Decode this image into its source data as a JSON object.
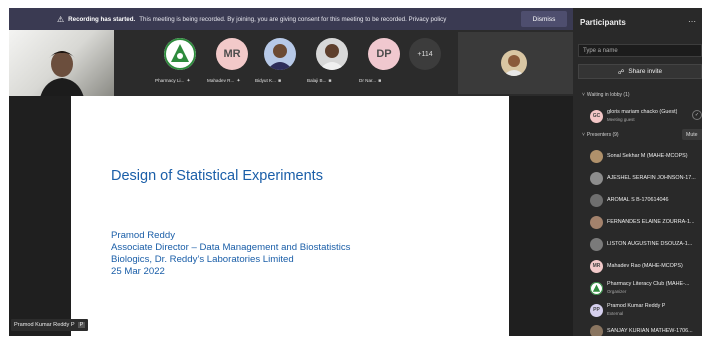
{
  "banner": {
    "title": "Recording has started.",
    "message": "This meeting is being recorded. By joining, you are giving consent for this meeting to be recorded. Privacy policy",
    "dismiss_label": "Dismiss"
  },
  "strip": {
    "tiles": [
      {
        "label": "Pharmacy Li...",
        "initials": "",
        "bg": "#ffffff",
        "icon": "club-logo-icon"
      },
      {
        "label": "Mahadev R...",
        "initials": "MR",
        "bg": "#f2c9c9",
        "icon": ""
      },
      {
        "label": "Bidyut K...",
        "initials": "",
        "bg": "#b7c9e8",
        "icon": "person-photo"
      },
      {
        "label": "Balaji B...",
        "initials": "",
        "bg": "#d8d8d8",
        "icon": "person-photo"
      },
      {
        "label": "Dr Nar...",
        "initials": "DP",
        "bg": "#f0c8cf",
        "icon": ""
      }
    ],
    "more_count": "+114"
  },
  "slide": {
    "title": "Design of Statistical Experiments",
    "lines": [
      "Pramod Reddy",
      "Associate Director – Data Management and Biostatistics",
      "Biologics, Dr. Reddy’s Laboratories Limited",
      "25 Mar 2022"
    ]
  },
  "presenter_tag": "Pramod Kumar Reddy P",
  "panel": {
    "title": "Participants",
    "search_placeholder": "Type a name",
    "invite_label": "Share invite",
    "lobby_header": "Waiting in lobby (1)",
    "lobby": [
      {
        "name": "gloris mariam chacko (Guest)",
        "sub": "Meeting guest",
        "initials": "GC",
        "bg": "#f3c6c6"
      }
    ],
    "presenters_header": "Presenters (9)",
    "mute_label": "Mute",
    "presenters": [
      {
        "name": "Sonal Sekhar M (MAHE-MCOPS)",
        "sub": "",
        "initials": "",
        "bg": "#b0916b"
      },
      {
        "name": "AJESHEL SERAFIN JOHNSON-17...",
        "sub": "",
        "initials": "",
        "bg": "#8d8d8d"
      },
      {
        "name": "AROMAL S B-170614046",
        "sub": "",
        "initials": "",
        "bg": "#6f6f6f"
      },
      {
        "name": "FERNANDES ELAINE ZOURRA-1...",
        "sub": "",
        "initials": "",
        "bg": "#a3826c"
      },
      {
        "name": "LISTON AUGUSTINE DSOUZA-1...",
        "sub": "",
        "initials": "",
        "bg": "#7a7a7a"
      },
      {
        "name": "Mahadev Rao (MAHE-MCOPS)",
        "sub": "",
        "initials": "MR",
        "bg": "#f2c9c9"
      },
      {
        "name": "Pharmacy Literacy Club (MAHE-...",
        "sub": "Organizer",
        "initials": "",
        "bg": "#ffffff"
      },
      {
        "name": "Pramod Kumar Reddy P",
        "sub": "External",
        "initials": "PP",
        "bg": "#d6d0ee"
      },
      {
        "name": "SANJAY KURIAN MATHEW-1706...",
        "sub": "",
        "initials": "",
        "bg": "#8a7560"
      }
    ]
  },
  "colors": {
    "slide_text": "#1a5ea8",
    "banner_bg": "#3a3a52",
    "panel_bg": "#292929"
  }
}
